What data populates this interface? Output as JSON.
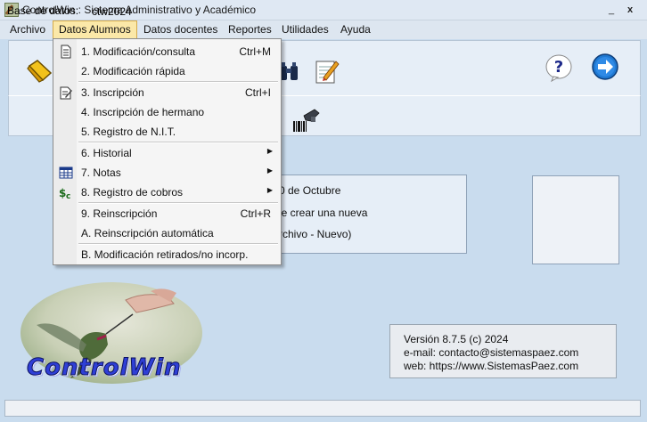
{
  "window": {
    "title": "ControlWin : Sistema Administrativo y Académico",
    "minimize": "_",
    "close": "x"
  },
  "menubar": {
    "items": [
      {
        "label": "Archivo"
      },
      {
        "label": "Datos Alumnos"
      },
      {
        "label": "Datos docentes"
      },
      {
        "label": "Reportes"
      },
      {
        "label": "Utilidades"
      },
      {
        "label": "Ayuda"
      }
    ]
  },
  "dropdown": {
    "items": [
      {
        "label": "1. Modificación/consulta",
        "shortcut": "Ctrl+M",
        "icon": "document-icon"
      },
      {
        "label": "2. Modificación rápida",
        "shortcut": ""
      },
      {
        "label": "3. Inscripción",
        "shortcut": "Ctrl+I",
        "icon": "edit-document-icon"
      },
      {
        "label": "4. Inscripción de hermano",
        "shortcut": ""
      },
      {
        "label": "5. Registro de N.I.T.",
        "shortcut": ""
      },
      {
        "label": "6. Historial",
        "submenu": true
      },
      {
        "label": "7. Notas",
        "submenu": true,
        "icon": "grid-table-icon"
      },
      {
        "label": "8. Registro de cobros",
        "submenu": true,
        "icon": "money-icon"
      },
      {
        "label": "9. Reinscripción",
        "shortcut": "Ctrl+R"
      },
      {
        "label": "A. Reinscripción automática",
        "shortcut": ""
      },
      {
        "label": "B. Modificación retirados/no incorp.",
        "shortcut": ""
      }
    ]
  },
  "info": {
    "line1": "0 de Octubre",
    "line2": "le crear una nueva",
    "line3": "rchivo - Nuevo)"
  },
  "database": {
    "label": "Base de datos:",
    "value": "ctw2024"
  },
  "logo": {
    "text": "ControlWin"
  },
  "version": {
    "line1": "Versión 8.7.5  (c) 2024",
    "line2": "e-mail: contacto@sistemaspaez.com",
    "line3": "web: https://www.SistemasPaez.com"
  },
  "icons": {
    "toolbar": [
      "folder-icon",
      "binoculars-icon",
      "notepad-edit-icon",
      "help-icon",
      "forward-arrow-icon",
      "barcode-scanner-icon"
    ]
  },
  "colors": {
    "menu_highlight": "#fbe8a8",
    "accent_blue": "#1f78d1",
    "logo_blue": "#2f3fd6"
  }
}
